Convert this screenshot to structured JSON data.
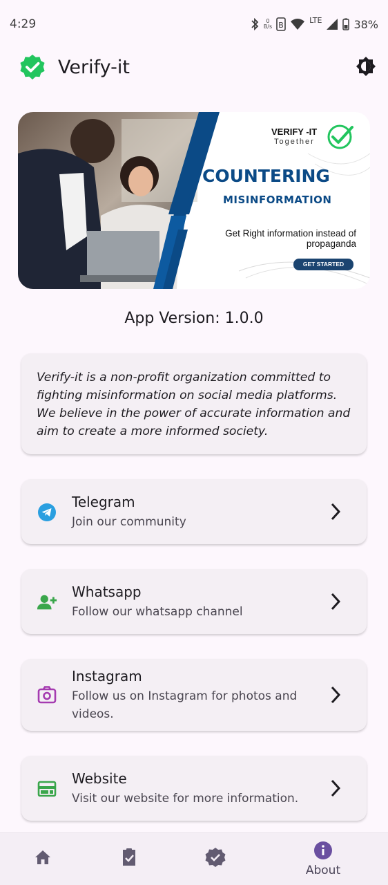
{
  "status_bar": {
    "time": "4:29",
    "net_speed_value": "0",
    "net_speed_unit": "B/s",
    "network": "LTE",
    "battery": "38%"
  },
  "app_bar": {
    "title": "Verify-it",
    "logo_icon": "verified-badge-icon",
    "theme_icon": "brightness-icon",
    "accent_color": "#22c55e"
  },
  "banner": {
    "brand": "VERIFY -IT",
    "tagline": "Together",
    "headline": "COUNTERING",
    "subheadline": "MISINFORMATION",
    "body": "Get Right information instead of propaganda",
    "cta": "GET STARTED",
    "colors": {
      "navy": "#0b4a86",
      "cta": "#1b4470"
    }
  },
  "version_text": "App Version: 1.0.0",
  "about": {
    "text": "Verify-it is a non-profit organization committed to fighting misinformation on social media platforms. We believe in the power of accurate information and aim to create a more informed society."
  },
  "links": [
    {
      "title": "Telegram",
      "subtitle": "Join our community",
      "icon": "telegram-icon",
      "color": "#2a9fe0"
    },
    {
      "title": "Whatsapp",
      "subtitle": "Follow our whatsapp channel",
      "icon": "group-add-icon",
      "color": "#3aa64b"
    },
    {
      "title": "Instagram",
      "subtitle": "Follow us on Instagram for photos and videos.",
      "icon": "camera-icon",
      "color": "#a53bb0"
    },
    {
      "title": "Website",
      "subtitle": "Visit our website for more information.",
      "icon": "web-icon",
      "color": "#3aa64b"
    }
  ],
  "bottom_nav": {
    "items": [
      {
        "icon": "home-icon",
        "label": ""
      },
      {
        "icon": "fact-check-icon",
        "label": ""
      },
      {
        "icon": "verified-icon",
        "label": ""
      },
      {
        "icon": "info-icon",
        "label": "About"
      }
    ],
    "active": "About",
    "active_color": "#6a4fa0"
  }
}
